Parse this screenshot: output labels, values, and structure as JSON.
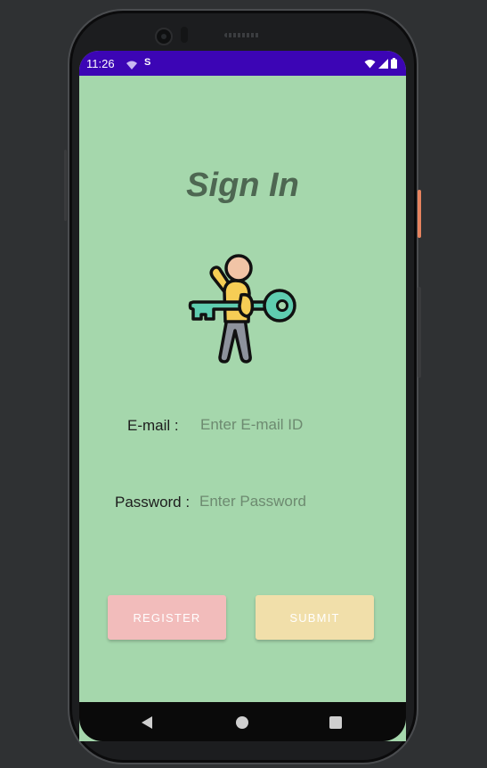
{
  "status_bar": {
    "time": "11:26",
    "notif_icon_2_text": "S",
    "icons": [
      "wifi-calling-icon",
      "sync-icon",
      "wifi-icon",
      "signal-icon",
      "battery-icon"
    ]
  },
  "screen": {
    "title": "Sign In",
    "illustration": "person-holding-key-icon",
    "email": {
      "label": "E-mail :",
      "placeholder": "Enter E-mail ID",
      "value": ""
    },
    "password": {
      "label": "Password :",
      "placeholder": "Enter Password",
      "value": ""
    },
    "buttons": {
      "register": "REGISTER",
      "submit": "SUBMIT"
    }
  },
  "colors": {
    "background": "#a5d7ac",
    "status_bar": "#3c05b5",
    "title": "#4e6752",
    "register_button": "#f2bcbb",
    "submit_button": "#f1dfaa",
    "key": "#5fcdb0",
    "shirt": "#f6cd55",
    "skin": "#f1c4a6",
    "pants": "#8d929c"
  },
  "nav_bar": {
    "items": [
      "back-icon",
      "home-icon",
      "recents-icon"
    ]
  }
}
